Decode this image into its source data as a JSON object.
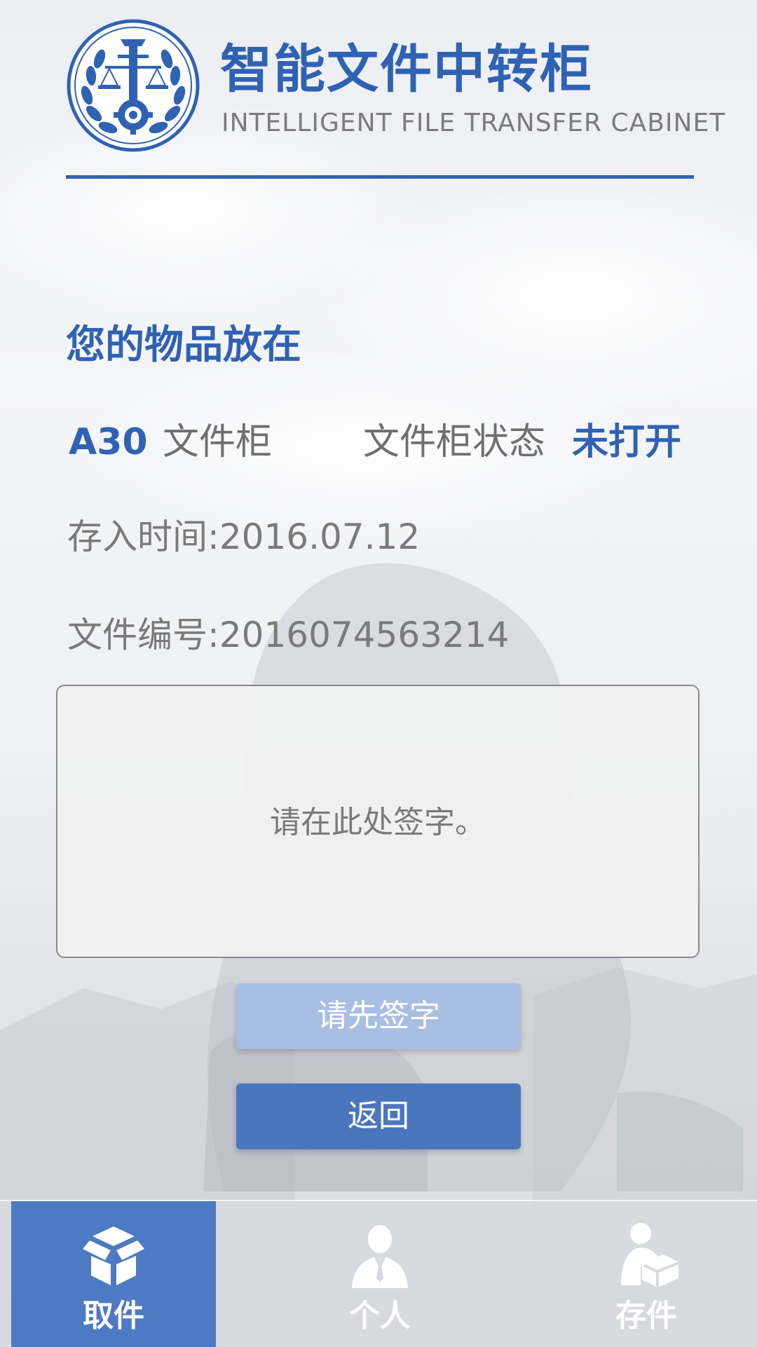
{
  "header": {
    "title_cn": "智能文件中转柜",
    "title_en": "INTELLIGENT FILE TRANSFER CABINET",
    "logo_icon": "court-emblem-icon"
  },
  "main": {
    "heading": "您的物品放在",
    "locker_number": "A30",
    "locker_word": "文件柜",
    "status_label": "文件柜状态",
    "status_value": "未打开",
    "deposit_time": "存入时间:2016.07.12",
    "file_number": "文件编号:2016074563214"
  },
  "signature": {
    "hint": "请在此处签字。"
  },
  "buttons": {
    "sign_first": "请先签字",
    "back": "返回"
  },
  "tabbar": {
    "items": [
      {
        "label": "取件",
        "icon": "open-box-icon",
        "active": true
      },
      {
        "label": "个人",
        "icon": "person-icon",
        "active": false
      },
      {
        "label": "存件",
        "icon": "person-with-box-icon",
        "active": false
      }
    ]
  },
  "colors": {
    "brand_blue": "#2f62b3",
    "button_blue": "#4a76bd",
    "button_disabled": "#a9bee3",
    "tab_active": "#4d7ac2"
  }
}
